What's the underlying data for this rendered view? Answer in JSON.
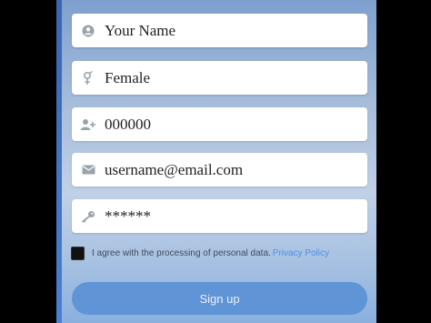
{
  "form": {
    "name": {
      "value": "Your Name",
      "icon": "user-icon"
    },
    "gender": {
      "value": "Female",
      "icon": "gender-icon"
    },
    "age": {
      "value": "000000",
      "icon": "add-user-icon"
    },
    "email": {
      "value": "username@email.com",
      "icon": "mail-icon"
    },
    "password": {
      "value": "******",
      "icon": "key-icon"
    }
  },
  "consent": {
    "text": "I agree with the processing of personal data.",
    "link": "Privacy Policy",
    "checked": true
  },
  "signup_label": "Sign up",
  "colors": {
    "button": "#5f95d6",
    "link": "#4f8fe8",
    "field_bg": "#ffffff"
  }
}
